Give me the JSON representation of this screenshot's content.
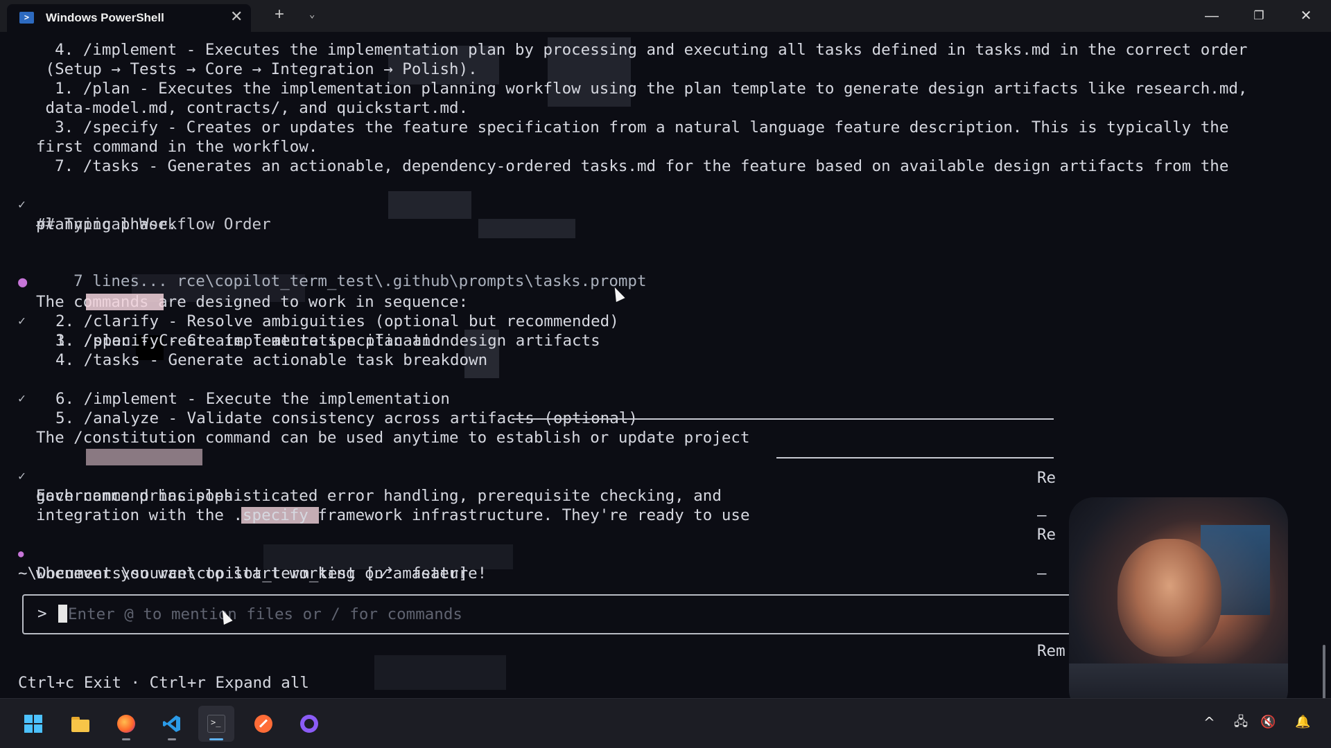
{
  "window": {
    "tab_title": "Windows PowerShell",
    "tab_close": "✕",
    "new_tab": "+",
    "tab_menu": "⌄",
    "minimize": "—",
    "maximize": "❐",
    "close": "✕"
  },
  "terminal": {
    "lines": [
      {
        "text": "  4. /implement - Executes the implementation plan by processing and executing all tasks defined in tasks.md in the correct order"
      },
      {
        "text": " (Setup → Tests → Core → Integration → Polish)."
      },
      {
        "text": "  1. /plan - Executes the implementation planning workflow using the plan template to generate design artifacts like research.md,"
      },
      {
        "text": " data-model.md, contracts/, and quickstart.md."
      },
      {
        "text": "  3. /specify - Creates or updates the feature specification from a natural language feature description. This is typically the"
      },
      {
        "text": "first command in the workflow."
      },
      {
        "text": "  7. /tasks - Generates an actionable, dependency-ordered tasks.md for the feature based on available design artifacts from the"
      },
      {
        "text": "planning phase."
      },
      {
        "text": "## Typical Workflow Order"
      },
      {
        "text": "The commands are designed to work in sequence:"
      },
      {
        "text": "    7 lines... rce\\copilot_term_test\\.github\\prompts\\tasks.prompt"
      },
      {
        "text": "1. /specify - Create feature specification"
      },
      {
        "text": "2. /clarify - Resolve ambiguities (optional but recommended)"
      },
      {
        "text": "3. /plan - Create implementation plan and design artifacts"
      },
      {
        "text": "4. /tasks - Generate actionable task breakdown"
      },
      {
        "text": "5. /analyze - Validate consistency across artifacts (optional)"
      },
      {
        "text": "6. /implement - Execute the implementation"
      },
      {
        "text": "The /constitution command can be used anytime to establish or update project"
      },
      {
        "text": "governance principles."
      },
      {
        "text": "Each command has sophisticated error handling, prerequisite checking, and"
      },
      {
        "text": "integration with the .specify framework infrastructure. They're ready to use"
      },
      {
        "text": "whenever you want to start working on a feature!"
      }
    ],
    "prompt_path": "~\\Documents\\source\\copilot_term_test [⎇ master]",
    "input_prompt": ">",
    "input_placeholder": "Enter @ to mention files or / for commands",
    "shortcuts": "Ctrl+c Exit · Ctrl+r Expand all",
    "right_column": [
      "Re",
      "—",
      "Re",
      "—",
      "Rem"
    ],
    "gutter_check": "✓",
    "gutter_dot": "●"
  },
  "taskbar": {
    "apps": [
      "start-icon",
      "file-explorer-icon",
      "firefox-icon",
      "vscode-icon",
      "terminal-icon",
      "postman-icon",
      "github-icon"
    ],
    "tray": {
      "chevron": "^",
      "network": "🖧",
      "volume": "🔇",
      "notifications": "🔔"
    }
  },
  "colors": {
    "background": "#0c0d14",
    "command_highlight_bg": "#f2d4dc",
    "command_highlight_fg": "#d7263d",
    "bullet": "#c775d8",
    "taskbar": "#1c1d24"
  }
}
